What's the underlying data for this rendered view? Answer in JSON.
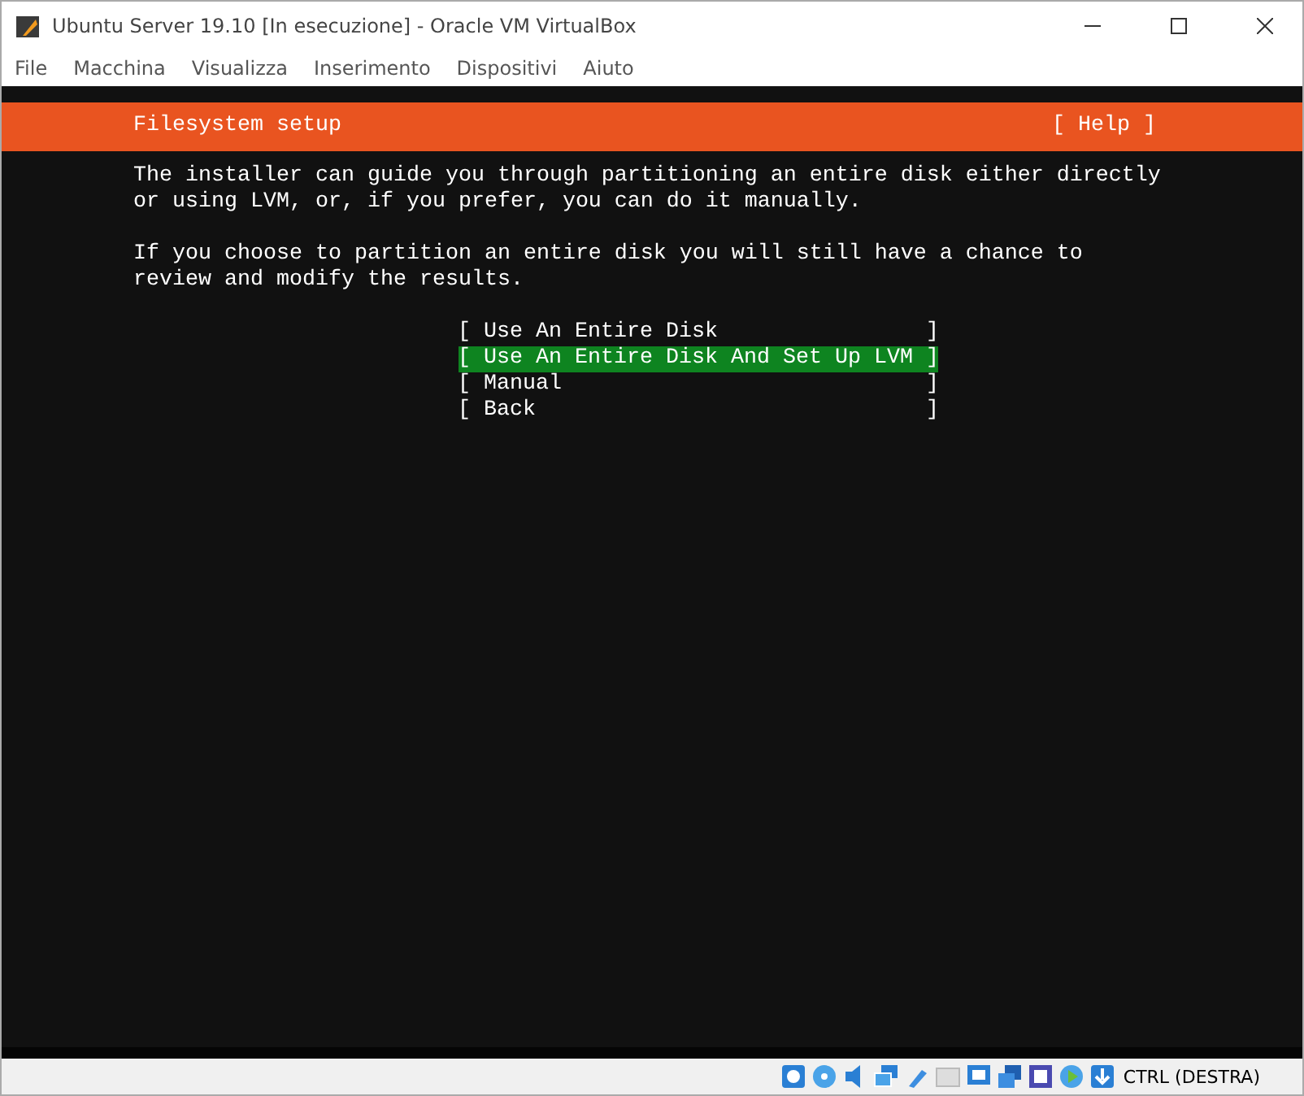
{
  "window": {
    "title": "Ubuntu Server 19.10 [In esecuzione] - Oracle VM VirtualBox"
  },
  "menu_bar": [
    "File",
    "Macchina",
    "Visualizza",
    "Inserimento",
    "Dispositivi",
    "Aiuto"
  ],
  "installer": {
    "title": "Filesystem setup",
    "help": "[ Help ]",
    "paragraphs": [
      [
        "The installer can guide you through partitioning an entire disk either directly",
        "or using LVM, or, if you prefer, you can do it manually."
      ],
      [
        "If you choose to partition an entire disk you will still have a chance to",
        "review and modify the results."
      ]
    ],
    "open_bracket": "[",
    "close_bracket": "]",
    "options": [
      {
        "label": "Use An Entire Disk",
        "selected": false
      },
      {
        "label": "Use An Entire Disk And Set Up LVM",
        "selected": true
      },
      {
        "label": "Manual",
        "selected": false
      },
      {
        "label": "Back",
        "selected": false
      }
    ]
  },
  "status_bar": {
    "host_key": "CTRL (DESTRA)"
  }
}
